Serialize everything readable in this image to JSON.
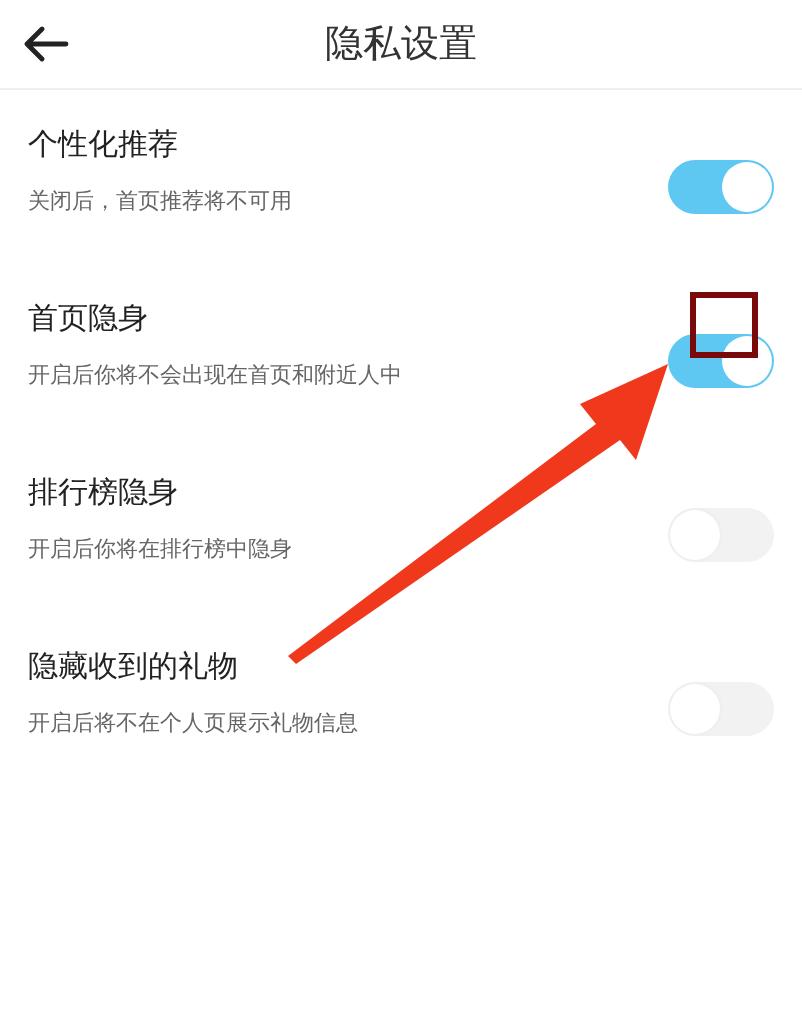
{
  "header": {
    "title": "隐私设置"
  },
  "settings": [
    {
      "title": "个性化推荐",
      "description": "关闭后，首页推荐将不可用",
      "on": true
    },
    {
      "title": "首页隐身",
      "description": "开启后你将不会出现在首页和附近人中",
      "on": true
    },
    {
      "title": "排行榜隐身",
      "description": "开启后你将在排行榜中隐身",
      "on": false
    },
    {
      "title": "隐藏收到的礼物",
      "description": "开启后将不在个人页展示礼物信息",
      "on": false
    }
  ]
}
